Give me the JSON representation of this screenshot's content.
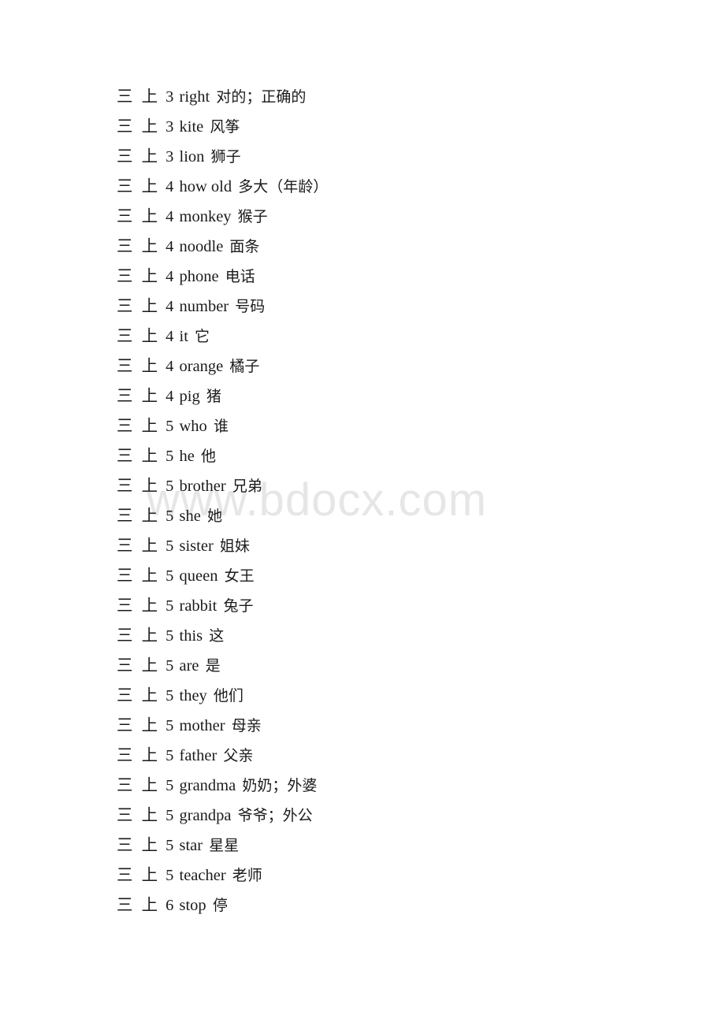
{
  "document": {
    "watermark": "www.bdocx.com",
    "page_background": "#ffffff",
    "text_color": "#1b1b1b",
    "watermark_color": "#e6e6e6"
  },
  "entries": [
    {
      "grade": "三 上",
      "unit": "3",
      "word": "right",
      "gloss": "对的；正确的"
    },
    {
      "grade": "三 上",
      "unit": "3",
      "word": "kite",
      "gloss": "风筝"
    },
    {
      "grade": "三 上",
      "unit": "3",
      "word": "lion",
      "gloss": "狮子"
    },
    {
      "grade": "三 上",
      "unit": "4",
      "word": "how old",
      "gloss": "多大（年龄）"
    },
    {
      "grade": "三 上",
      "unit": "4",
      "word": "monkey",
      "gloss": "猴子"
    },
    {
      "grade": "三 上",
      "unit": "4",
      "word": "noodle",
      "gloss": "面条"
    },
    {
      "grade": "三 上",
      "unit": "4",
      "word": "phone",
      "gloss": "电话"
    },
    {
      "grade": "三 上",
      "unit": "4",
      "word": "number",
      "gloss": "号码"
    },
    {
      "grade": "三 上",
      "unit": "4",
      "word": "it",
      "gloss": "它"
    },
    {
      "grade": "三 上",
      "unit": "4",
      "word": "orange",
      "gloss": "橘子"
    },
    {
      "grade": "三 上",
      "unit": "4",
      "word": "pig",
      "gloss": "猪"
    },
    {
      "grade": "三 上",
      "unit": "5",
      "word": "who",
      "gloss": "谁"
    },
    {
      "grade": "三 上",
      "unit": "5",
      "word": "he",
      "gloss": "他"
    },
    {
      "grade": "三 上",
      "unit": "5",
      "word": "brother",
      "gloss": "兄弟"
    },
    {
      "grade": "三 上",
      "unit": "5",
      "word": "she",
      "gloss": "她"
    },
    {
      "grade": "三 上",
      "unit": "5",
      "word": "sister",
      "gloss": "姐妹"
    },
    {
      "grade": "三 上",
      "unit": "5",
      "word": "queen",
      "gloss": "女王"
    },
    {
      "grade": "三 上",
      "unit": "5",
      "word": "rabbit",
      "gloss": "兔子"
    },
    {
      "grade": "三 上",
      "unit": "5",
      "word": "this",
      "gloss": "这"
    },
    {
      "grade": "三 上",
      "unit": "5",
      "word": "are",
      "gloss": "是"
    },
    {
      "grade": "三 上",
      "unit": "5",
      "word": "they",
      "gloss": "他们"
    },
    {
      "grade": "三 上",
      "unit": "5",
      "word": "mother",
      "gloss": "母亲"
    },
    {
      "grade": "三 上",
      "unit": "5",
      "word": "father",
      "gloss": "父亲"
    },
    {
      "grade": "三 上",
      "unit": "5",
      "word": "grandma",
      "gloss": "奶奶；外婆"
    },
    {
      "grade": "三 上",
      "unit": "5",
      "word": "grandpa",
      "gloss": "爷爷；外公"
    },
    {
      "grade": "三 上",
      "unit": "5",
      "word": "star",
      "gloss": "星星"
    },
    {
      "grade": "三 上",
      "unit": "5",
      "word": "teacher",
      "gloss": "老师"
    },
    {
      "grade": "三 上",
      "unit": "6",
      "word": "stop",
      "gloss": "停"
    }
  ]
}
